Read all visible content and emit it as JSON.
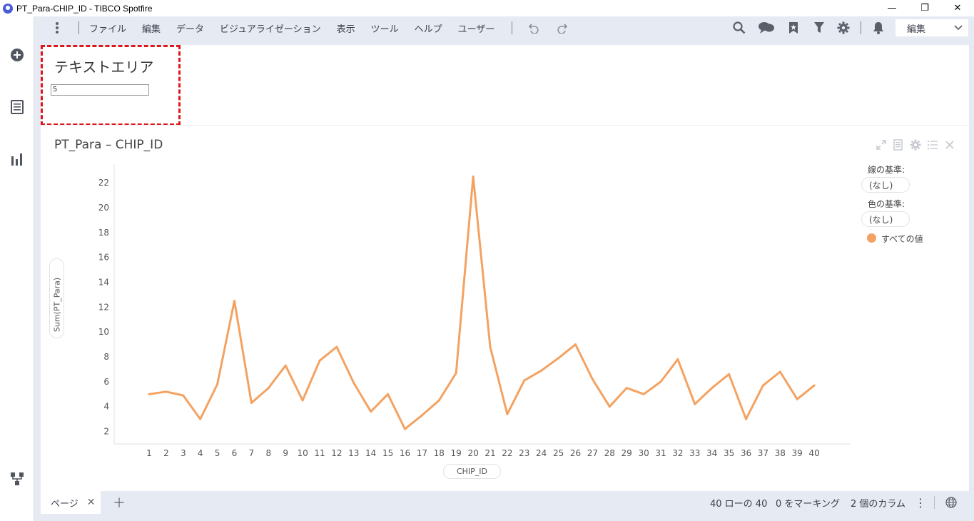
{
  "window": {
    "title": "PT_Para-CHIP_ID - TIBCO Spotfire",
    "minimize": "—",
    "restore": "❐",
    "close": "✕"
  },
  "menubar": {
    "items": [
      "ファイル",
      "編集",
      "データ",
      "ビジュアライゼーション",
      "表示",
      "ツール",
      "ヘルプ",
      "ユーザー"
    ],
    "mode_label": "編集"
  },
  "icons": {
    "more_menu": "kebab-vertical-icon",
    "undo": "undo-icon",
    "redo": "redo-icon",
    "search": "search-icon",
    "collaboration": "chat-bubbles-icon",
    "bookmarks": "bookmark-star-icon",
    "filters": "filter-icon",
    "settings": "gear-icon",
    "notifications": "bell-icon",
    "rail_add": "plus-circle-icon",
    "rail_data": "list-icon",
    "rail_viz": "bar-chart-icon",
    "rail_flow": "data-flow-icon"
  },
  "text_area": {
    "title": "テキストエリア",
    "input_value": "5"
  },
  "visualization": {
    "title": "PT_Para – CHIP_ID",
    "legend": {
      "line_by_label": "線の基準:",
      "line_by_value": "(なし)",
      "color_by_label": "色の基準:",
      "color_by_value": "(なし)",
      "entry": "すべての値",
      "entry_color": "#f4a261"
    }
  },
  "chart_data": {
    "type": "line",
    "xlabel": "CHIP_ID",
    "ylabel": "Sum(PT_Para)",
    "x": [
      1,
      2,
      3,
      4,
      5,
      6,
      7,
      8,
      9,
      10,
      11,
      12,
      13,
      14,
      15,
      16,
      17,
      18,
      19,
      20,
      21,
      22,
      23,
      24,
      25,
      26,
      27,
      28,
      29,
      30,
      31,
      32,
      33,
      34,
      35,
      36,
      37,
      38,
      39,
      40
    ],
    "series": [
      {
        "name": "すべての値",
        "color": "#f4a261",
        "values": [
          5.0,
          5.2,
          4.9,
          3.0,
          5.8,
          12.5,
          4.3,
          5.5,
          7.3,
          4.5,
          7.7,
          8.8,
          5.9,
          3.6,
          5.0,
          2.2,
          3.3,
          4.5,
          6.7,
          22.5,
          8.8,
          3.4,
          6.1,
          6.9,
          7.9,
          9.0,
          6.2,
          4.0,
          5.5,
          5.0,
          6.0,
          7.8,
          4.2,
          5.5,
          6.6,
          3.0,
          5.7,
          6.8,
          4.6,
          5.7
        ]
      }
    ],
    "yticks": [
      2,
      4,
      6,
      8,
      10,
      12,
      14,
      16,
      18,
      20,
      22
    ],
    "ylim": [
      1,
      23.5
    ],
    "grid": false,
    "legend_position": "right"
  },
  "footer": {
    "page_tab": "ページ",
    "page_tab_close": "✕",
    "add_page": "＋",
    "rows": "40 ローの 40",
    "marked": "0 をマーキング",
    "columns": "2 個のカラム",
    "more": "⋮"
  }
}
